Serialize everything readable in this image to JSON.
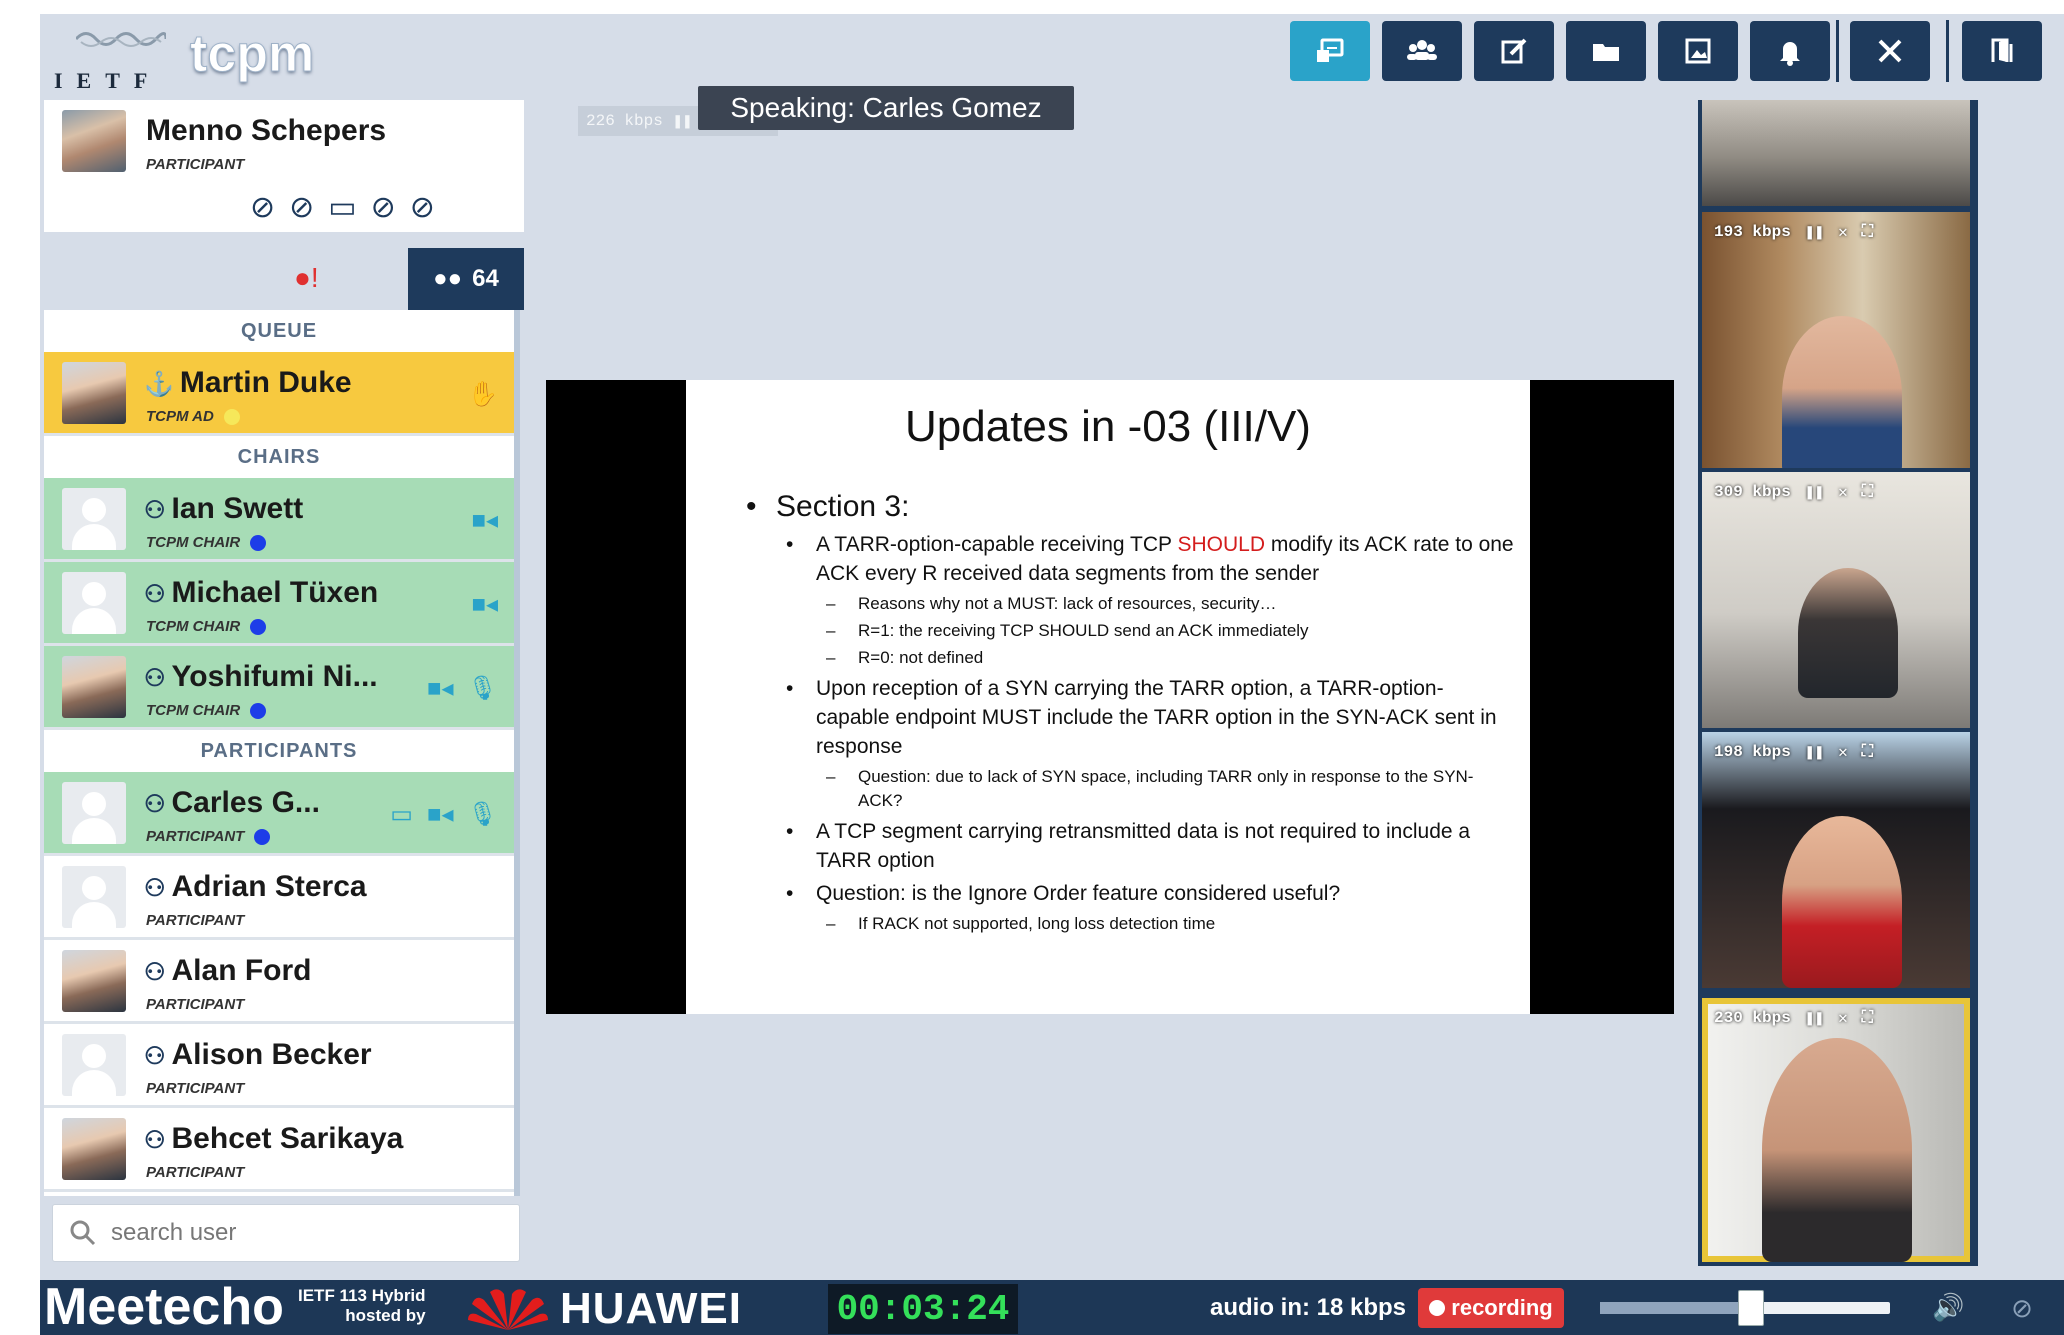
{
  "header": {
    "org": "IETF",
    "room": "tcpm",
    "toolbar": [
      {
        "name": "slides-button",
        "icon": "presentation-icon",
        "active": true
      },
      {
        "name": "participants-button",
        "icon": "users-icon",
        "active": false
      },
      {
        "name": "notepad-button",
        "icon": "edit-icon",
        "active": false
      },
      {
        "name": "files-button",
        "icon": "folder-icon",
        "active": false
      },
      {
        "name": "whiteboard-button",
        "icon": "image-icon",
        "active": false
      },
      {
        "name": "notifications-button",
        "icon": "bell-icon",
        "active": false
      },
      {
        "name": "tools-button",
        "icon": "tools-icon",
        "active": false
      },
      {
        "name": "leave-button",
        "icon": "exit-icon",
        "active": false
      }
    ]
  },
  "me": {
    "name": "Menno Schepers",
    "role": "PARTICIPANT",
    "controls": [
      "mic-off-icon",
      "camera-off-icon",
      "screenshare-off-icon",
      "video-off-icon",
      "hand-off-icon"
    ]
  },
  "tabs": {
    "chat_badge": "!",
    "users_count": "64"
  },
  "queue": {
    "header": "QUEUE",
    "items": [
      {
        "name": "Martin Duke",
        "role": "TCPM AD"
      }
    ]
  },
  "chairs": {
    "header": "CHAIRS",
    "items": [
      {
        "name": "Ian Swett",
        "role": "TCPM CHAIR"
      },
      {
        "name": "Michael Tüxen",
        "role": "TCPM CHAIR"
      },
      {
        "name": "Yoshifumi Ni...",
        "role": "TCPM CHAIR"
      }
    ]
  },
  "participants": {
    "header": "PARTICIPANTS",
    "items": [
      {
        "name": "Carles G...",
        "role": "PARTICIPANT"
      },
      {
        "name": "Adrian Sterca",
        "role": "PARTICIPANT"
      },
      {
        "name": "Alan Ford",
        "role": "PARTICIPANT"
      },
      {
        "name": "Alison Becker",
        "role": "PARTICIPANT"
      },
      {
        "name": "Behcet Sarikaya",
        "role": "PARTICIPANT"
      }
    ]
  },
  "search": {
    "placeholder": "search user"
  },
  "stage": {
    "speaking": "Speaking: Carles Gomez",
    "main_kbps": "226 kbps"
  },
  "slide": {
    "title": "Updates in -03 (III/V)",
    "section": "Section 3:",
    "b1_pre": "A TARR-option-capable receiving TCP ",
    "b1_red": "SHOULD",
    "b1_post": " modify its ACK rate to one ACK every R received data segments from the sender",
    "b1_s1": "Reasons why not a MUST: lack of resources, security…",
    "b1_s2": "R=1: the receiving TCP SHOULD send an ACK immediately",
    "b1_s3": "R=0: not defined",
    "b2": "Upon reception of a SYN carrying the TARR option, a TARR-option-capable endpoint MUST include the TARR option in the SYN-ACK sent in response",
    "b2_s1": "Question: due to lack of SYN space, including TARR only in response to the SYN-ACK?",
    "b3": "A TCP segment carrying retransmitted data is not required to include a TARR option",
    "b4": "Question: is the Ignore Order feature considered useful?",
    "b4_s1": "If RACK not supported, long loss detection time"
  },
  "thumbnails": [
    {
      "kbps": "193 kbps"
    },
    {
      "kbps": "309 kbps"
    },
    {
      "kbps": "198 kbps"
    },
    {
      "kbps": "230 kbps"
    }
  ],
  "footer": {
    "brand": "Meetecho",
    "event_line1": "IETF 113 Hybrid",
    "event_line2": "hosted by",
    "sponsor": "HUAWEI",
    "timer": "00:03:24",
    "audio_in": "audio in: 18 kbps",
    "recording": "recording",
    "volume": 0.52
  },
  "colors": {
    "navy": "#1e3a5c",
    "accent": "#2aa3c9",
    "queue": "#f7c93f",
    "chair": "#a7dcb6",
    "recording": "#e03a3a",
    "timer": "#34e05a"
  }
}
